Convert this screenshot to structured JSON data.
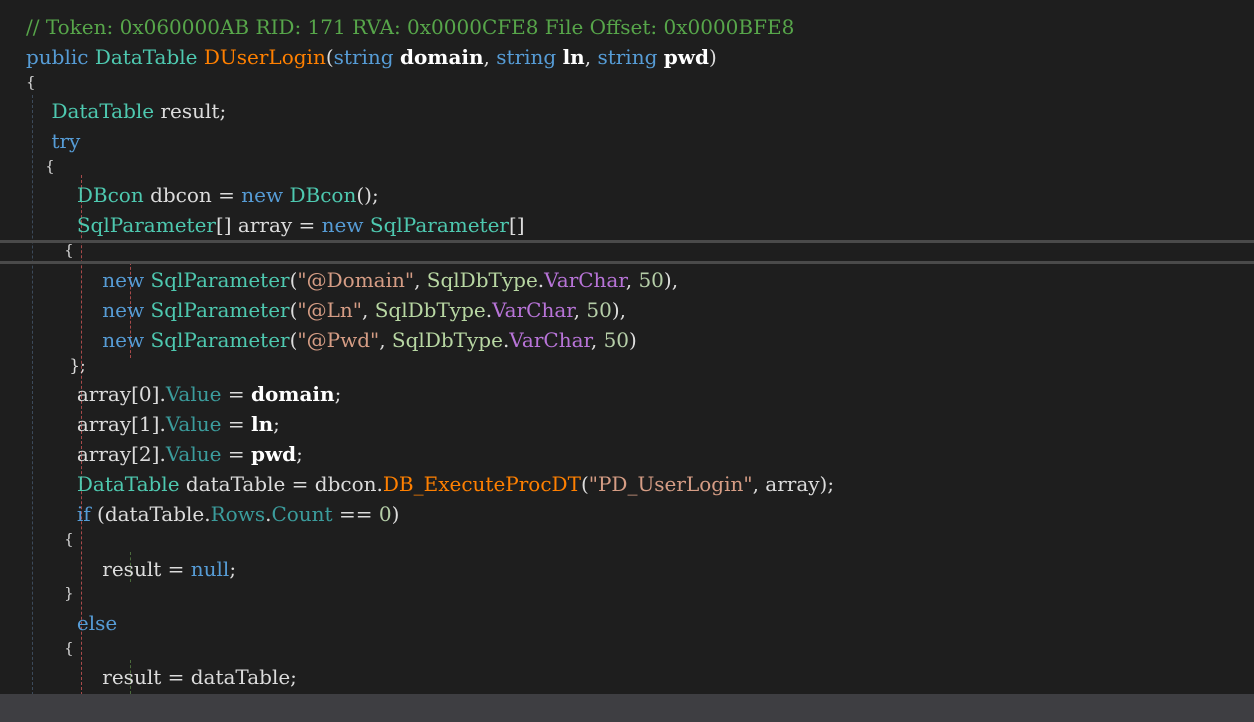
{
  "lines": [
    {
      "tokens": [
        {
          "t": "// Token: 0x060000AB RID: 171 RVA: 0x0000CFE8 File Offset: 0x0000BFE8",
          "c": "comment"
        }
      ]
    },
    {
      "tokens": [
        {
          "t": "public ",
          "c": "keyword"
        },
        {
          "t": "DataTable ",
          "c": "type"
        },
        {
          "t": "DUserLogin",
          "c": "method"
        },
        {
          "t": "(",
          "c": "plain"
        },
        {
          "t": "string ",
          "c": "keyword"
        },
        {
          "t": "domain",
          "c": "param"
        },
        {
          "t": ", ",
          "c": "plain"
        },
        {
          "t": "string ",
          "c": "keyword"
        },
        {
          "t": "ln",
          "c": "param"
        },
        {
          "t": ", ",
          "c": "plain"
        },
        {
          "t": "string ",
          "c": "keyword"
        },
        {
          "t": "pwd",
          "c": "param"
        },
        {
          "t": ")",
          "c": "plain"
        }
      ]
    },
    {
      "tokens": [
        {
          "t": "{",
          "c": "plain"
        }
      ]
    },
    {
      "tokens": [
        {
          "t": "    ",
          "c": "plain"
        },
        {
          "t": "DataTable ",
          "c": "type"
        },
        {
          "t": "result;",
          "c": "plain"
        }
      ]
    },
    {
      "tokens": [
        {
          "t": "    ",
          "c": "plain"
        },
        {
          "t": "try",
          "c": "keyword"
        }
      ]
    },
    {
      "tokens": [
        {
          "t": "    {",
          "c": "plain"
        }
      ]
    },
    {
      "tokens": [
        {
          "t": "        ",
          "c": "plain"
        },
        {
          "t": "DBcon ",
          "c": "type"
        },
        {
          "t": "dbcon = ",
          "c": "plain"
        },
        {
          "t": "new ",
          "c": "keyword"
        },
        {
          "t": "DBcon",
          "c": "type"
        },
        {
          "t": "();",
          "c": "plain"
        }
      ]
    },
    {
      "tokens": [
        {
          "t": "        ",
          "c": "plain"
        },
        {
          "t": "SqlParameter",
          "c": "type"
        },
        {
          "t": "[] array = ",
          "c": "plain"
        },
        {
          "t": "new ",
          "c": "keyword"
        },
        {
          "t": "SqlParameter",
          "c": "type"
        },
        {
          "t": "[]",
          "c": "plain"
        }
      ]
    },
    {
      "tokens": [
        {
          "t": "        {",
          "c": "plain"
        }
      ]
    },
    {
      "tokens": [
        {
          "t": "            ",
          "c": "plain"
        },
        {
          "t": "new ",
          "c": "keyword"
        },
        {
          "t": "SqlParameter",
          "c": "type"
        },
        {
          "t": "(",
          "c": "plain"
        },
        {
          "t": "\"@Domain\"",
          "c": "string"
        },
        {
          "t": ", ",
          "c": "plain"
        },
        {
          "t": "SqlDbType",
          "c": "enum"
        },
        {
          "t": ".",
          "c": "plain"
        },
        {
          "t": "VarChar",
          "c": "purple"
        },
        {
          "t": ", ",
          "c": "plain"
        },
        {
          "t": "50",
          "c": "number"
        },
        {
          "t": "),",
          "c": "plain"
        }
      ]
    },
    {
      "tokens": [
        {
          "t": "            ",
          "c": "plain"
        },
        {
          "t": "new ",
          "c": "keyword"
        },
        {
          "t": "SqlParameter",
          "c": "type"
        },
        {
          "t": "(",
          "c": "plain"
        },
        {
          "t": "\"@Ln\"",
          "c": "string"
        },
        {
          "t": ", ",
          "c": "plain"
        },
        {
          "t": "SqlDbType",
          "c": "enum"
        },
        {
          "t": ".",
          "c": "plain"
        },
        {
          "t": "VarChar",
          "c": "purple"
        },
        {
          "t": ", ",
          "c": "plain"
        },
        {
          "t": "50",
          "c": "number"
        },
        {
          "t": "),",
          "c": "plain"
        }
      ]
    },
    {
      "tokens": [
        {
          "t": "            ",
          "c": "plain"
        },
        {
          "t": "new ",
          "c": "keyword"
        },
        {
          "t": "SqlParameter",
          "c": "type"
        },
        {
          "t": "(",
          "c": "plain"
        },
        {
          "t": "\"@Pwd\"",
          "c": "string"
        },
        {
          "t": ", ",
          "c": "plain"
        },
        {
          "t": "SqlDbType",
          "c": "enum"
        },
        {
          "t": ".",
          "c": "plain"
        },
        {
          "t": "VarChar",
          "c": "purple"
        },
        {
          "t": ", ",
          "c": "plain"
        },
        {
          "t": "50",
          "c": "number"
        },
        {
          "t": ")",
          "c": "plain"
        }
      ]
    },
    {
      "tokens": [
        {
          "t": "        };",
          "c": "plain"
        }
      ]
    },
    {
      "tokens": [
        {
          "t": "        array[0].",
          "c": "plain"
        },
        {
          "t": "Value",
          "c": "property"
        },
        {
          "t": " = ",
          "c": "plain"
        },
        {
          "t": "domain",
          "c": "param"
        },
        {
          "t": ";",
          "c": "plain"
        }
      ]
    },
    {
      "tokens": [
        {
          "t": "        array[1].",
          "c": "plain"
        },
        {
          "t": "Value",
          "c": "property"
        },
        {
          "t": " = ",
          "c": "plain"
        },
        {
          "t": "ln",
          "c": "param"
        },
        {
          "t": ";",
          "c": "plain"
        }
      ]
    },
    {
      "tokens": [
        {
          "t": "        array[2].",
          "c": "plain"
        },
        {
          "t": "Value",
          "c": "property"
        },
        {
          "t": " = ",
          "c": "plain"
        },
        {
          "t": "pwd",
          "c": "param"
        },
        {
          "t": ";",
          "c": "plain"
        }
      ]
    },
    {
      "tokens": [
        {
          "t": "        ",
          "c": "plain"
        },
        {
          "t": "DataTable ",
          "c": "type"
        },
        {
          "t": "dataTable = dbcon.",
          "c": "plain"
        },
        {
          "t": "DB_ExecuteProcDT",
          "c": "method"
        },
        {
          "t": "(",
          "c": "plain"
        },
        {
          "t": "\"PD_UserLogin\"",
          "c": "string"
        },
        {
          "t": ", array);",
          "c": "plain"
        }
      ]
    },
    {
      "tokens": [
        {
          "t": "        ",
          "c": "plain"
        },
        {
          "t": "if ",
          "c": "keyword"
        },
        {
          "t": "(dataTable.",
          "c": "plain"
        },
        {
          "t": "Rows",
          "c": "property"
        },
        {
          "t": ".",
          "c": "plain"
        },
        {
          "t": "Count",
          "c": "property"
        },
        {
          "t": " == ",
          "c": "plain"
        },
        {
          "t": "0",
          "c": "number"
        },
        {
          "t": ")",
          "c": "plain"
        }
      ]
    },
    {
      "tokens": [
        {
          "t": "        {",
          "c": "plain"
        }
      ]
    },
    {
      "tokens": [
        {
          "t": "            result = ",
          "c": "plain"
        },
        {
          "t": "null",
          "c": "keyword"
        },
        {
          "t": ";",
          "c": "plain"
        }
      ]
    },
    {
      "tokens": [
        {
          "t": "        }",
          "c": "plain"
        }
      ]
    },
    {
      "tokens": [
        {
          "t": "        ",
          "c": "plain"
        },
        {
          "t": "else",
          "c": "keyword"
        }
      ]
    },
    {
      "tokens": [
        {
          "t": "        {",
          "c": "plain"
        }
      ]
    },
    {
      "tokens": [
        {
          "t": "            result = dataTable;",
          "c": "plain"
        }
      ]
    }
  ]
}
